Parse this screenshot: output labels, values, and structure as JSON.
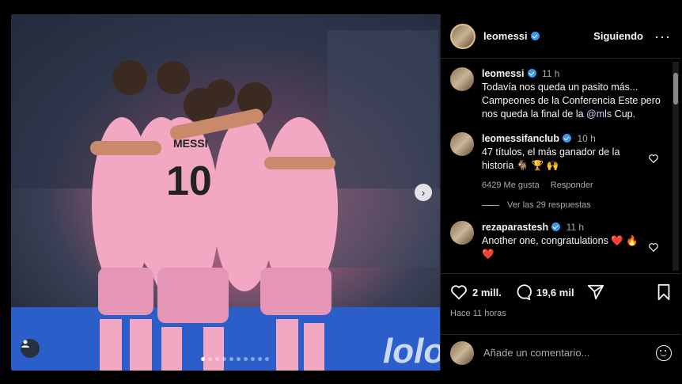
{
  "post": {
    "username": "leomessi",
    "follow_state": "Siguiendo",
    "more_label": "···"
  },
  "caption": {
    "username": "leomessi",
    "time": "11 h",
    "text_1": "Todavía nos queda un pasito más...",
    "text_2": "Campeones de la Conferencia Este pero",
    "text_3_pre": "nos queda la final de la ",
    "mention": "@mls",
    "text_3_post": " Cup."
  },
  "comments": [
    {
      "username": "leomessifanclub",
      "time": "10 h",
      "text_1": "47 títulos, el más ganador de la",
      "text_2": "historia 🐐 🏆 🙌",
      "likes": "6429 Me gusta",
      "reply_label": "Responder",
      "view_replies": "Ver las 29 respuestas"
    },
    {
      "username": "rezaparastesh",
      "time": "11 h",
      "text_1": "Another one, congratulations ❤️ 🔥",
      "text_2": "❤️"
    }
  ],
  "actions": {
    "likes": "2 mill.",
    "comments": "19,6 mil",
    "posted_ago": "Hace 11 horas"
  },
  "add_comment": {
    "placeholder": "Añade un comentario..."
  },
  "photo": {
    "jersey_name": "MESSI",
    "jersey_number": "10",
    "carousel_count": 10,
    "carousel_active": 1
  },
  "colors": {
    "background": "#000000",
    "verified": "#3897f0",
    "jersey_pink": "#f2a7c3",
    "heart_red": "#ff3040"
  }
}
